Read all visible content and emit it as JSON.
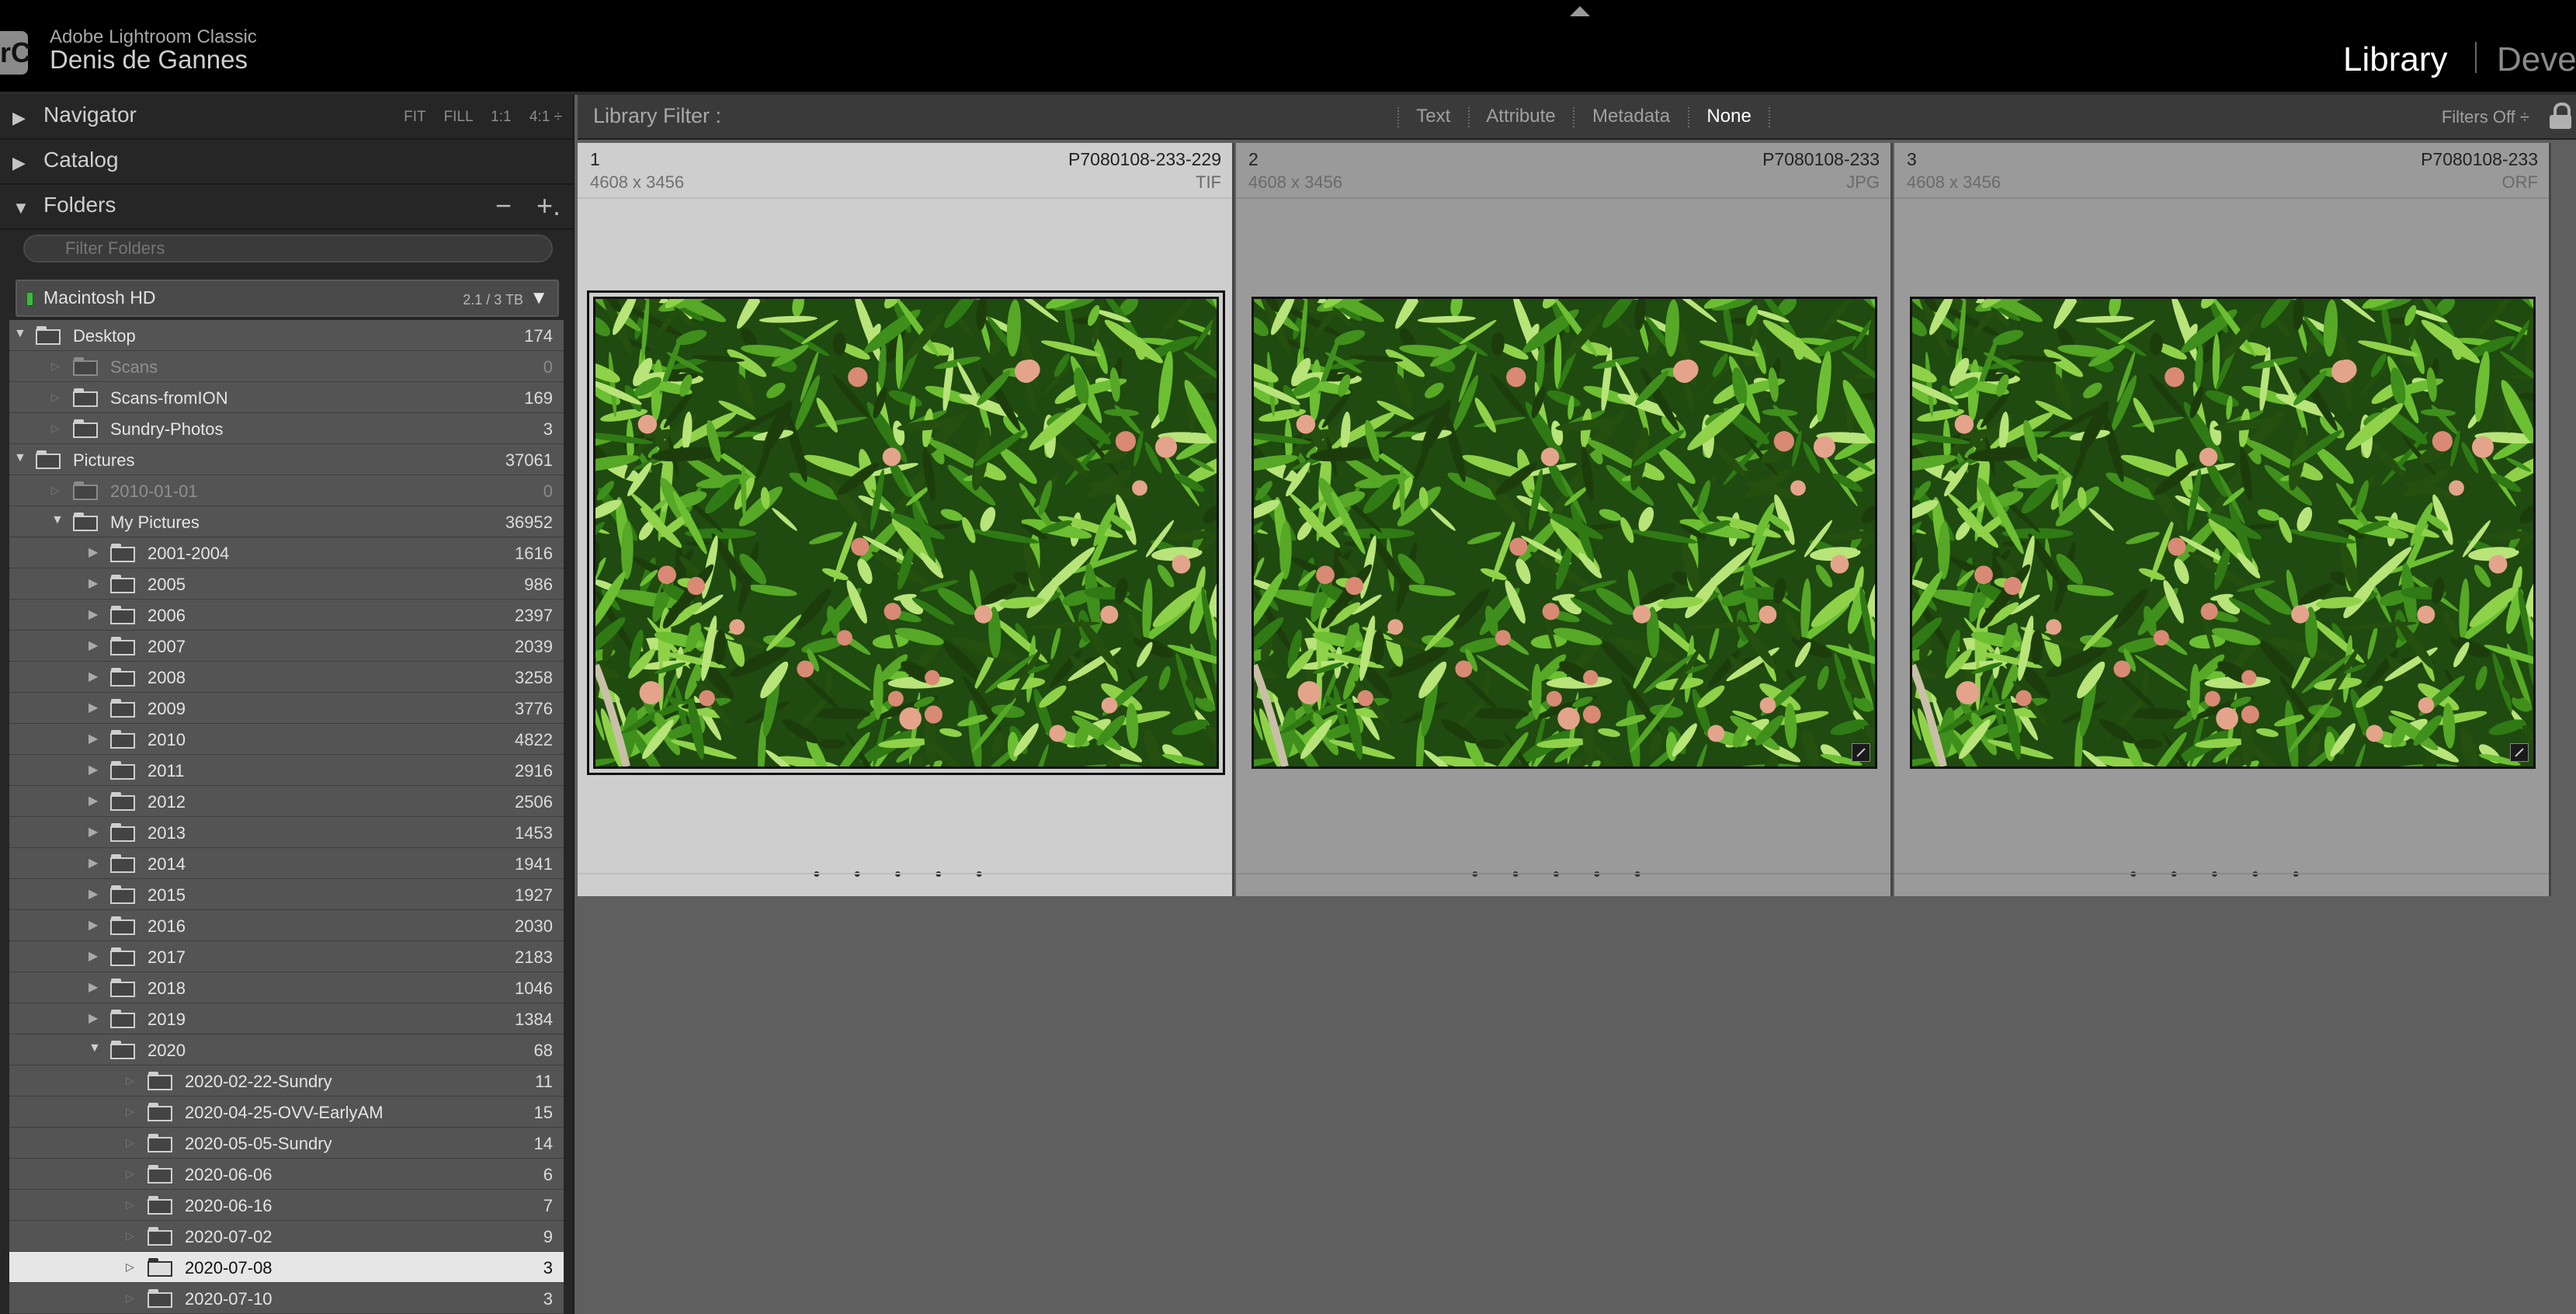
{
  "app": {
    "name": "Adobe Lightroom Classic",
    "user": "Denis de Gannes",
    "logo_text": "rC"
  },
  "modules": {
    "library": "Library",
    "develop": "Devel"
  },
  "panels": {
    "navigator": {
      "title": "Navigator",
      "zoom": [
        "FIT",
        "FILL",
        "1:1",
        "4:1 ÷"
      ]
    },
    "catalog": {
      "title": "Catalog"
    },
    "folders": {
      "title": "Folders",
      "minus": "−",
      "plus": "+.",
      "filter_placeholder": "Filter Folders"
    }
  },
  "volume": {
    "name": "Macintosh HD",
    "size": "2.1 / 3 TB"
  },
  "folders": [
    {
      "name": "Desktop",
      "count": "174",
      "level": 1,
      "state": "open",
      "dim": false,
      "selected": false
    },
    {
      "name": "Scans",
      "count": "0",
      "level": 2,
      "state": "leaf",
      "dim": true,
      "selected": false
    },
    {
      "name": "Scans-fromION",
      "count": "169",
      "level": 2,
      "state": "leaf",
      "dim": false,
      "selected": false
    },
    {
      "name": "Sundry-Photos",
      "count": "3",
      "level": 2,
      "state": "leaf",
      "dim": false,
      "selected": false
    },
    {
      "name": "Pictures",
      "count": "37061",
      "level": 1,
      "state": "open",
      "dim": false,
      "selected": false
    },
    {
      "name": "2010-01-01",
      "count": "0",
      "level": 2,
      "state": "leaf",
      "dim": true,
      "selected": false
    },
    {
      "name": "My Pictures",
      "count": "36952",
      "level": 2,
      "state": "open",
      "dim": false,
      "selected": false
    },
    {
      "name": "2001-2004",
      "count": "1616",
      "level": 3,
      "state": "closed",
      "dim": false,
      "selected": false
    },
    {
      "name": "2005",
      "count": "986",
      "level": 3,
      "state": "closed",
      "dim": false,
      "selected": false
    },
    {
      "name": "2006",
      "count": "2397",
      "level": 3,
      "state": "closed",
      "dim": false,
      "selected": false
    },
    {
      "name": "2007",
      "count": "2039",
      "level": 3,
      "state": "closed",
      "dim": false,
      "selected": false
    },
    {
      "name": "2008",
      "count": "3258",
      "level": 3,
      "state": "closed",
      "dim": false,
      "selected": false
    },
    {
      "name": "2009",
      "count": "3776",
      "level": 3,
      "state": "closed",
      "dim": false,
      "selected": false
    },
    {
      "name": "2010",
      "count": "4822",
      "level": 3,
      "state": "closed",
      "dim": false,
      "selected": false
    },
    {
      "name": "2011",
      "count": "2916",
      "level": 3,
      "state": "closed",
      "dim": false,
      "selected": false
    },
    {
      "name": "2012",
      "count": "2506",
      "level": 3,
      "state": "closed",
      "dim": false,
      "selected": false
    },
    {
      "name": "2013",
      "count": "1453",
      "level": 3,
      "state": "closed",
      "dim": false,
      "selected": false
    },
    {
      "name": "2014",
      "count": "1941",
      "level": 3,
      "state": "closed",
      "dim": false,
      "selected": false
    },
    {
      "name": "2015",
      "count": "1927",
      "level": 3,
      "state": "closed",
      "dim": false,
      "selected": false
    },
    {
      "name": "2016",
      "count": "2030",
      "level": 3,
      "state": "closed",
      "dim": false,
      "selected": false
    },
    {
      "name": "2017",
      "count": "2183",
      "level": 3,
      "state": "closed",
      "dim": false,
      "selected": false
    },
    {
      "name": "2018",
      "count": "1046",
      "level": 3,
      "state": "closed",
      "dim": false,
      "selected": false
    },
    {
      "name": "2019",
      "count": "1384",
      "level": 3,
      "state": "closed",
      "dim": false,
      "selected": false
    },
    {
      "name": "2020",
      "count": "68",
      "level": 3,
      "state": "open",
      "dim": false,
      "selected": false
    },
    {
      "name": "2020-02-22-Sundry",
      "count": "11",
      "level": 4,
      "state": "leaf",
      "dim": false,
      "selected": false
    },
    {
      "name": "2020-04-25-OVV-EarlyAM",
      "count": "15",
      "level": 4,
      "state": "leaf",
      "dim": false,
      "selected": false
    },
    {
      "name": "2020-05-05-Sundry",
      "count": "14",
      "level": 4,
      "state": "leaf",
      "dim": false,
      "selected": false
    },
    {
      "name": "2020-06-06",
      "count": "6",
      "level": 4,
      "state": "leaf",
      "dim": false,
      "selected": false
    },
    {
      "name": "2020-06-16",
      "count": "7",
      "level": 4,
      "state": "leaf",
      "dim": false,
      "selected": false
    },
    {
      "name": "2020-07-02",
      "count": "9",
      "level": 4,
      "state": "leaf",
      "dim": false,
      "selected": false
    },
    {
      "name": "2020-07-08",
      "count": "3",
      "level": 4,
      "state": "leaf",
      "dim": false,
      "selected": true
    },
    {
      "name": "2020-07-10",
      "count": "3",
      "level": 4,
      "state": "leaf",
      "dim": false,
      "selected": false
    }
  ],
  "library_filter": {
    "label": "Library Filter :",
    "options": [
      "Text",
      "Attribute",
      "Metadata",
      "None"
    ],
    "active": "None",
    "preset": "Filters Off ÷"
  },
  "photos": [
    {
      "index": "1",
      "filename": "P7080108-233-229",
      "dimensions": "4608 x 3456",
      "type": "TIF",
      "rating_dots": "• • • • •",
      "selected": true,
      "developed": false
    },
    {
      "index": "2",
      "filename": "P7080108-233",
      "dimensions": "4608 x 3456",
      "type": "JPG",
      "rating_dots": "• • • • •",
      "selected": false,
      "developed": true
    },
    {
      "index": "3",
      "filename": "P7080108-233",
      "dimensions": "4608 x 3456",
      "type": "ORF",
      "rating_dots": "• • • • •",
      "selected": false,
      "developed": true
    }
  ],
  "colors": {
    "chrome_black": "#000000",
    "panel": "#262626",
    "grid_bg": "#5f5f5f",
    "cell_selected": "#cecece",
    "cell": "#9a9a9a",
    "foliage": "#3f8f1c",
    "fruit": "#e4a48c"
  }
}
